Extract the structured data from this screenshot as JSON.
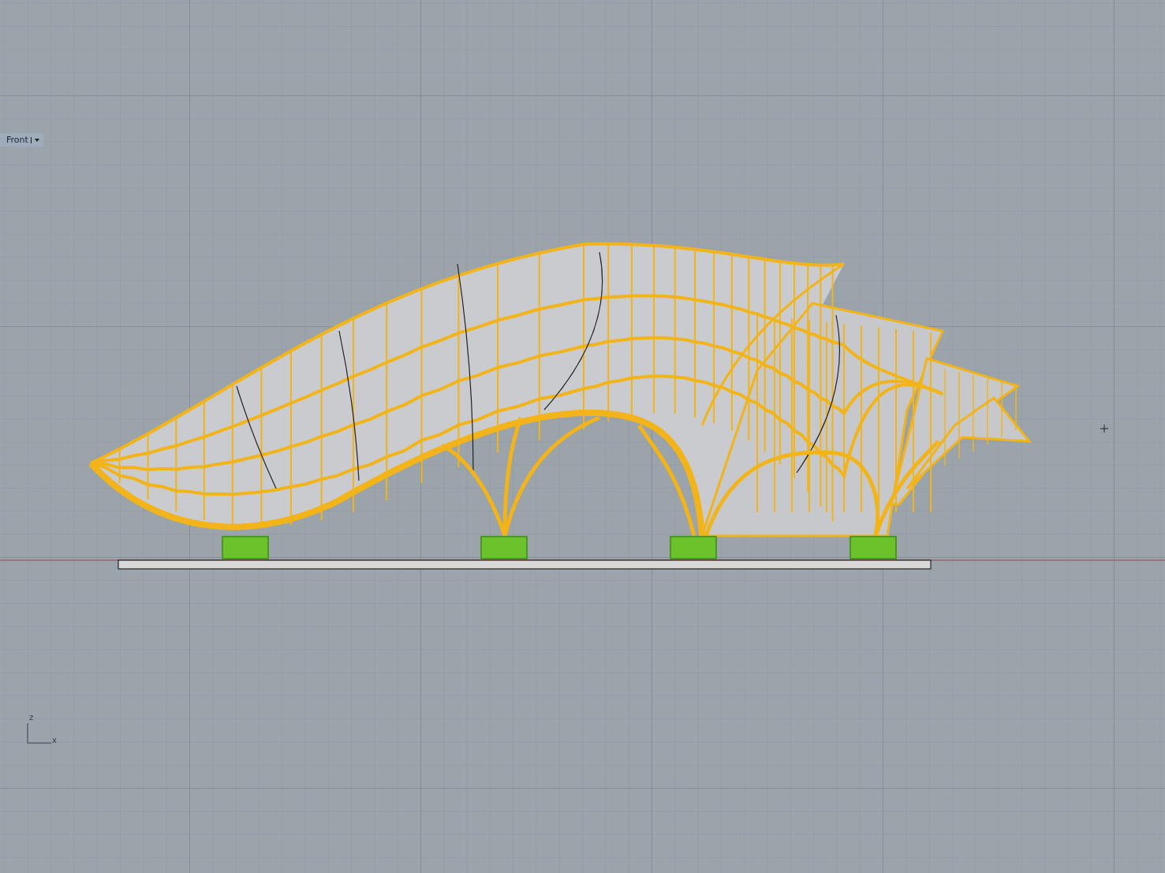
{
  "viewport": {
    "title": "Front",
    "axes": [
      {
        "label": "z"
      },
      {
        "label": "x"
      }
    ]
  }
}
